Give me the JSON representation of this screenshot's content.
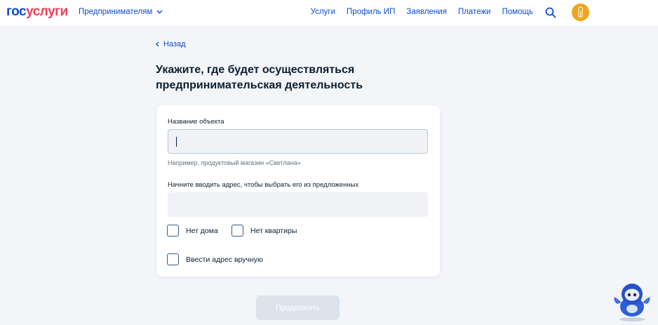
{
  "header": {
    "logo_part1": "гос",
    "logo_part2": "услуги",
    "segment_label": "Предпринимателям",
    "nav": [
      "Услуги",
      "Профиль ИП",
      "Заявления",
      "Платежи",
      "Помощь"
    ],
    "icons": {
      "search": "search-icon",
      "avatar": "avatar-icon",
      "chevron": "chevron-down-icon"
    }
  },
  "page": {
    "back_label": "Назад",
    "title": "Укажите, где будет осуществляться предпринимательская деятельность"
  },
  "form": {
    "object_name_label": "Название объекта",
    "object_name_value": "",
    "object_name_hint": "Например, продуктовый магазин «Светлана»",
    "address_label": "Начните вводить адрес, чтобы выбрать его из предложенных",
    "address_value": "",
    "checkboxes": {
      "no_house": "Нет дома",
      "no_apartment": "Нет квартиры",
      "manual_address": "Ввести адрес вручную"
    }
  },
  "continue_label": "Продолжить",
  "colors": {
    "accent": "#0d4cd3",
    "brand_red": "#ee3f58",
    "background": "#f3f5f8",
    "avatar": "#f0a51e"
  }
}
